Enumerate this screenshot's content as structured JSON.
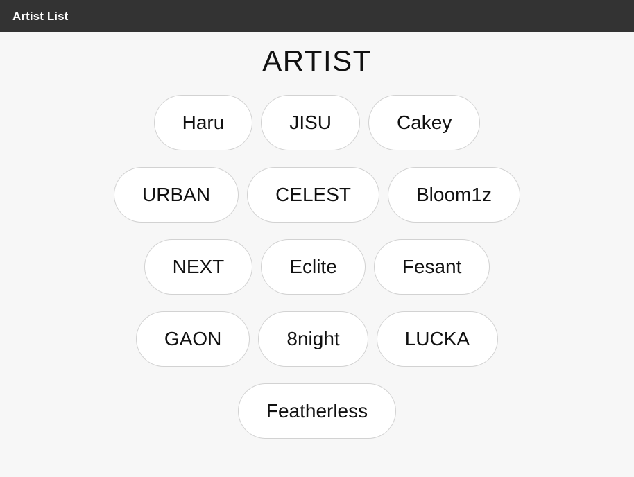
{
  "appbar": {
    "title": "Artist List"
  },
  "main": {
    "heading": "ARTIST",
    "artists": [
      {
        "name": "Haru"
      },
      {
        "name": "JISU"
      },
      {
        "name": "Cakey"
      },
      {
        "name": "URBAN"
      },
      {
        "name": "CELEST"
      },
      {
        "name": "Bloom1z"
      },
      {
        "name": "NEXT"
      },
      {
        "name": "Eclite"
      },
      {
        "name": "Fesant"
      },
      {
        "name": "GAON"
      },
      {
        "name": "8night"
      },
      {
        "name": "LUCKA"
      },
      {
        "name": "Featherless"
      }
    ]
  },
  "colors": {
    "appbar_background": "#333333",
    "appbar_text": "#ffffff",
    "page_background": "#f7f7f7",
    "pill_background": "#ffffff",
    "pill_border": "#d2d2d2",
    "text": "#111111"
  }
}
